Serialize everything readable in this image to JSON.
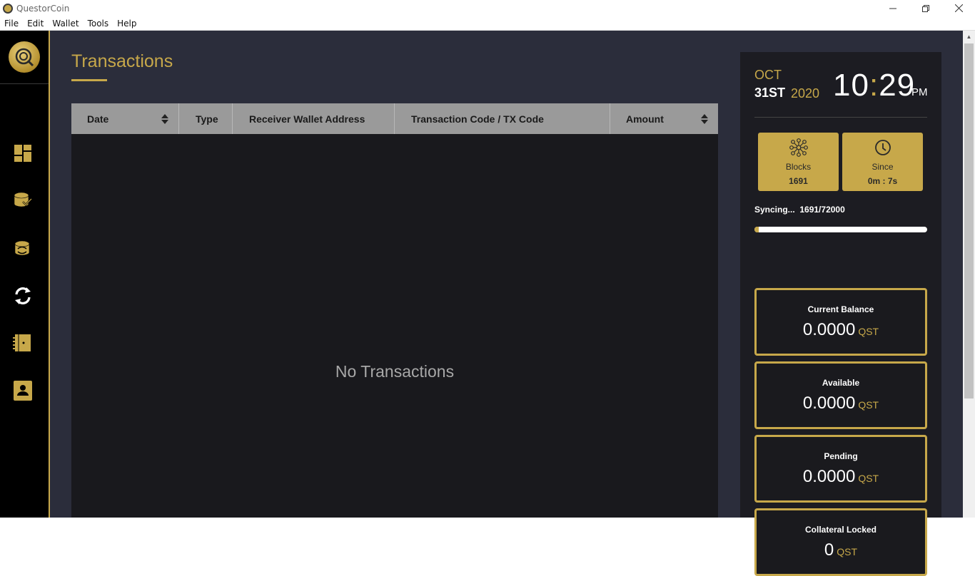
{
  "window": {
    "title": "QuestorCoin"
  },
  "menu": [
    "File",
    "Edit",
    "Wallet",
    "Tools",
    "Help"
  ],
  "sidebar": {
    "items": [
      {
        "name": "dashboard-icon"
      },
      {
        "name": "send-coins-icon"
      },
      {
        "name": "receive-coins-icon"
      },
      {
        "name": "transactions-icon"
      },
      {
        "name": "masternodes-icon"
      },
      {
        "name": "address-book-icon"
      }
    ]
  },
  "main": {
    "title": "Transactions",
    "table": {
      "columns": [
        "Date",
        "Type",
        "Receiver Wallet Address",
        "Transaction Code / TX Code",
        "Amount"
      ],
      "empty_message": "No Transactions"
    }
  },
  "right": {
    "month": "OCT",
    "day": "31ST",
    "year": "2020",
    "hour": "10",
    "minute": "29",
    "ampm": "PM",
    "blocks": {
      "label": "Blocks",
      "value": "1691"
    },
    "since": {
      "label": "Since",
      "value": "0m : 7s"
    },
    "sync": {
      "label": "Syncing...",
      "value": "1691/72000",
      "progress": 0.0235
    },
    "balances": [
      {
        "label": "Current Balance",
        "value": "0.0000",
        "unit": "QST"
      },
      {
        "label": "Available",
        "value": "0.0000",
        "unit": "QST"
      },
      {
        "label": "Pending",
        "value": "0.0000",
        "unit": "QST"
      },
      {
        "label": "Collateral Locked",
        "value": "0",
        "unit": "QST"
      }
    ]
  },
  "colors": {
    "accent": "#c7a84a",
    "background": "#2b2d3b",
    "sidebar": "#000000"
  }
}
